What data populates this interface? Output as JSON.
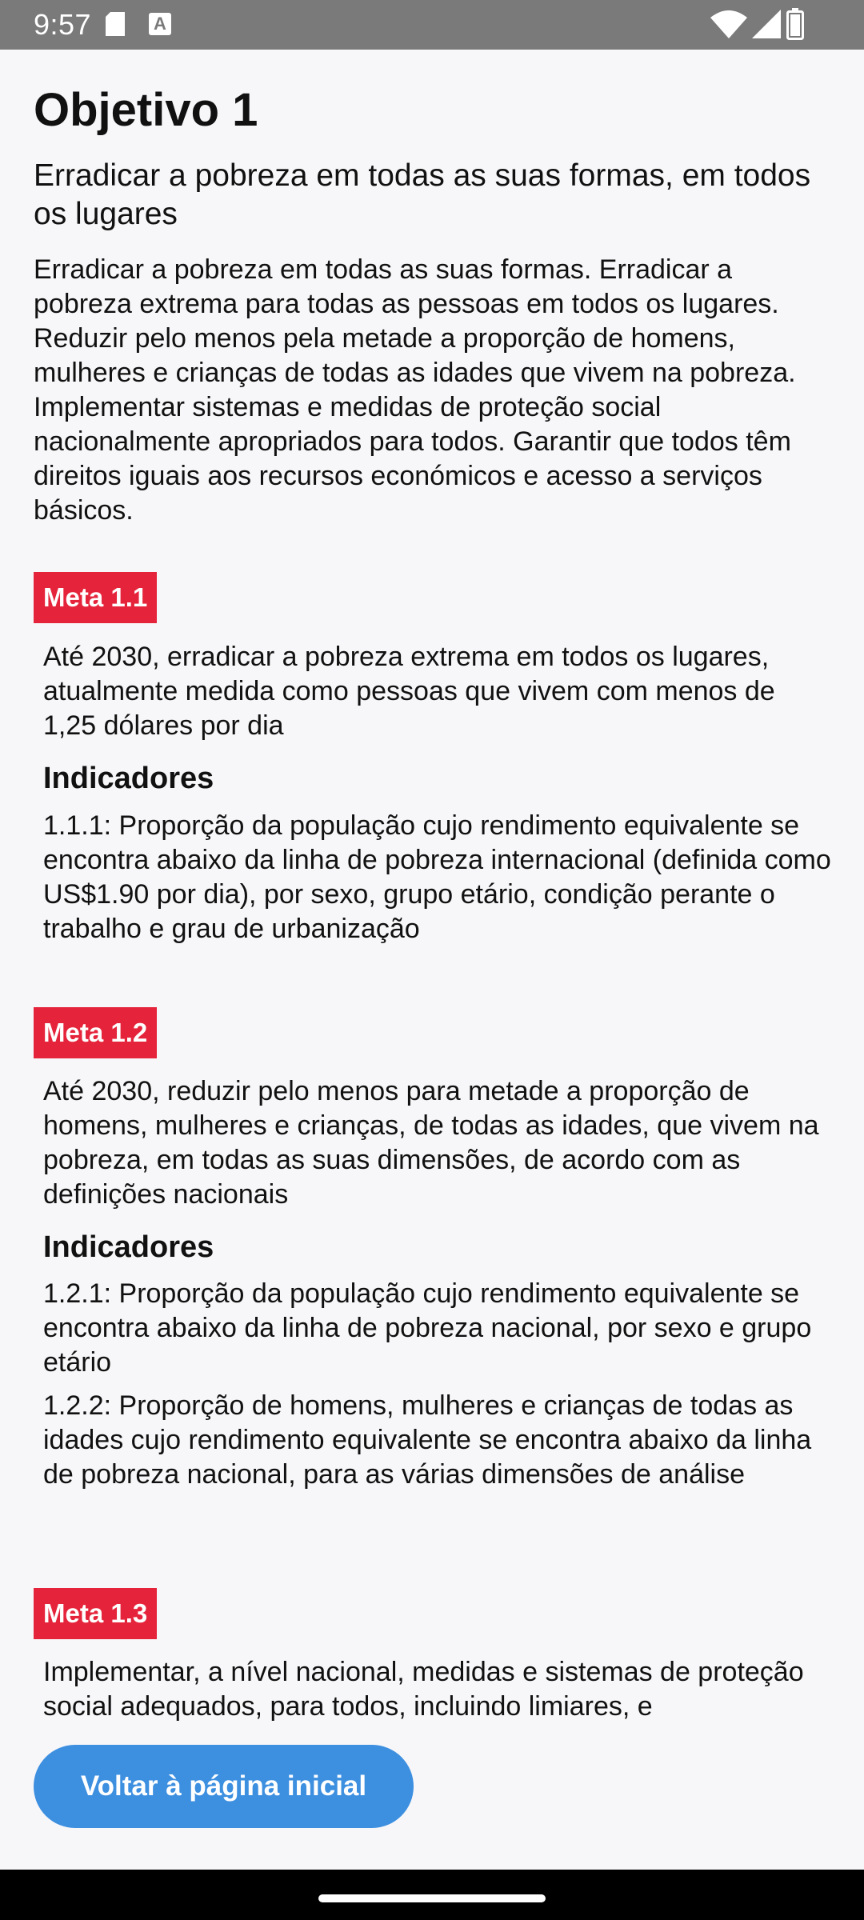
{
  "status_bar": {
    "time": "9:57",
    "a_label": "A"
  },
  "page": {
    "title": "Objetivo 1",
    "subtitle": "Erradicar a pobreza em todas as suas formas, em todos os lugares",
    "description": "Erradicar a pobreza em todas as suas formas. Erradicar a pobreza extrema para todas as pessoas em todos os lugares. Reduzir pelo menos pela metade a proporção de homens, mulheres e crianças de todas as idades que vivem na pobreza. Implementar sistemas e medidas de proteção social nacionalmente apropriados para todos. Garantir que todos têm direitos iguais aos recursos económicos e acesso a serviços básicos."
  },
  "metas": [
    {
      "label": "Meta 1.1",
      "text": "Até 2030, erradicar a pobreza extrema em todos os lugares, atualmente medida como pessoas que vivem com menos de 1,25 dólares por dia",
      "indicators_heading": "Indicadores",
      "indicators": [
        "1.1.1: Proporção da população cujo rendimento equivalente se encontra abaixo da linha de pobreza internacional (definida como US$1.90 por dia), por sexo, grupo etário, condição perante o trabalho e grau de urbanização"
      ]
    },
    {
      "label": "Meta 1.2",
      "text": "Até 2030, reduzir pelo menos para metade a proporção de homens, mulheres e crianças, de todas as idades, que vivem na pobreza, em todas as suas dimensões, de acordo com as definições nacionais",
      "indicators_heading": "Indicadores",
      "indicators": [
        "1.2.1: Proporção da população cujo rendimento equivalente se encontra abaixo da linha de pobreza nacional, por sexo e grupo etário",
        "1.2.2: Proporção de homens, mulheres e crianças de todas as idades cujo rendimento equivalente se encontra abaixo da linha de pobreza nacional, para as várias dimensões de análise"
      ]
    },
    {
      "label": "Meta 1.3",
      "text": "Implementar, a nível nacional, medidas e sistemas de proteção social adequados, para todos, incluindo limiares, e"
    }
  ],
  "home_button_label": "Voltar à página inicial",
  "colors": {
    "meta_badge": "#e5243b",
    "button": "#3d8fe0",
    "status_bar": "#7a7a7a"
  }
}
